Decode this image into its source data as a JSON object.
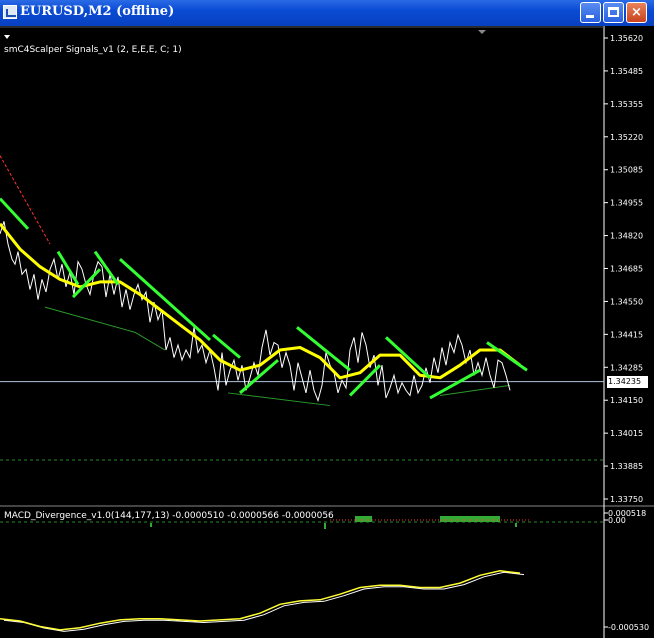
{
  "window": {
    "title": "EURUSD,M2 (offline)",
    "buttons": {
      "minimize": "minimize",
      "maximize": "maximize",
      "close": "×"
    }
  },
  "colors": {
    "background": "#000000",
    "axis": "#ffffff",
    "price_line": "#ffffff",
    "ma_line": "#ffff00",
    "signal_line": "#33ff33",
    "red_dash": "#ff3333",
    "divergence_line": "#2a9a2a",
    "current_price_line": "#b0c4de"
  },
  "indicators": {
    "main": "smC4Scalper Signals_v1 (2, E,E,E, C; 1)",
    "macd": "MACD_Divergence_v1.0(144,177,13) -0.0000510 -0.0000566 -0.0000056"
  },
  "price_axis": {
    "ticks": [
      "1.35620",
      "1.35485",
      "1.35355",
      "1.35220",
      "1.35085",
      "1.34955",
      "1.34820",
      "1.34685",
      "1.34550",
      "1.34415",
      "1.34285",
      "1.34150",
      "1.34015",
      "1.33885",
      "1.33750"
    ],
    "current_price": "1.34235"
  },
  "macd_axis": {
    "top": "0.000518",
    "zero": "0.00",
    "bottom": "-0.000530"
  },
  "chart_data": {
    "type": "line",
    "ylim": [
      1.3375,
      1.3562
    ],
    "price_x": [
      0,
      4,
      8,
      12,
      15,
      18,
      22,
      26,
      30,
      34,
      38,
      42,
      46,
      50,
      54,
      58,
      62,
      66,
      70,
      74,
      78,
      82,
      86,
      90,
      94,
      98,
      102,
      106,
      110,
      114,
      118,
      122,
      126,
      130,
      134,
      138,
      142,
      146,
      150,
      154,
      158,
      162,
      166,
      170,
      174,
      178,
      182,
      186,
      190,
      194,
      198,
      202,
      206,
      210,
      214,
      218,
      222,
      226,
      230,
      234,
      238,
      242,
      246,
      250,
      254,
      258,
      262,
      266,
      270,
      274,
      278,
      282,
      286,
      290,
      294,
      298,
      302,
      306,
      310,
      314,
      318,
      322,
      326,
      330,
      334,
      338,
      342,
      346,
      350,
      354,
      358,
      362,
      366,
      370,
      374,
      378,
      382,
      386,
      390,
      394,
      398,
      402,
      406,
      410,
      414,
      418,
      422,
      426,
      430,
      434,
      438,
      442,
      446,
      450,
      454,
      458,
      462,
      466,
      470,
      474,
      478,
      482,
      486,
      490,
      494,
      498,
      502,
      506,
      510,
      514,
      518,
      522,
      526
    ],
    "price_y": [
      1.3482,
      1.3487,
      1.3478,
      1.3472,
      1.347,
      1.3475,
      1.3466,
      1.3468,
      1.346,
      1.3466,
      1.3456,
      1.3464,
      1.3459,
      1.3468,
      1.3472,
      1.3464,
      1.347,
      1.3461,
      1.3467,
      1.3458,
      1.3471,
      1.3468,
      1.3462,
      1.3458,
      1.3466,
      1.3471,
      1.3469,
      1.3457,
      1.3466,
      1.3458,
      1.3465,
      1.3453,
      1.346,
      1.3452,
      1.3458,
      1.3462,
      1.3456,
      1.3459,
      1.3447,
      1.3455,
      1.3448,
      1.3452,
      1.3436,
      1.3441,
      1.3433,
      1.3438,
      1.3432,
      1.3436,
      1.3433,
      1.3445,
      1.3435,
      1.3438,
      1.3431,
      1.3436,
      1.3429,
      1.342,
      1.3435,
      1.3422,
      1.3428,
      1.3432,
      1.3424,
      1.343,
      1.342,
      1.3425,
      1.3431,
      1.3426,
      1.3437,
      1.3444,
      1.3434,
      1.3439,
      1.3438,
      1.3429,
      1.3435,
      1.343,
      1.342,
      1.3431,
      1.3425,
      1.3419,
      1.3428,
      1.342,
      1.3416,
      1.3422,
      1.3435,
      1.343,
      1.3427,
      1.3419,
      1.3424,
      1.3421,
      1.3436,
      1.3441,
      1.3431,
      1.3443,
      1.3438,
      1.3429,
      1.3434,
      1.3422,
      1.343,
      1.3417,
      1.3421,
      1.3426,
      1.3419,
      1.3423,
      1.342,
      1.3418,
      1.3426,
      1.3419,
      1.3422,
      1.3429,
      1.3423,
      1.3433,
      1.3427,
      1.3437,
      1.343,
      1.3439,
      1.3435,
      1.3442,
      1.3438,
      1.3431,
      1.3436,
      1.3426,
      1.3431,
      1.3426,
      1.3433,
      1.3426,
      1.3421,
      1.3432,
      1.3431,
      1.3426,
      1.342
    ],
    "ma_x": [
      0,
      20,
      40,
      60,
      80,
      100,
      120,
      140,
      160,
      180,
      200,
      220,
      240,
      260,
      280,
      300,
      320,
      340,
      360,
      380,
      400,
      420,
      440,
      460,
      480,
      500,
      520
    ],
    "ma_y": [
      1.3486,
      1.3476,
      1.3469,
      1.3464,
      1.3461,
      1.3463,
      1.3463,
      1.3458,
      1.3452,
      1.3446,
      1.344,
      1.3432,
      1.3428,
      1.343,
      1.3436,
      1.3437,
      1.3433,
      1.3425,
      1.3427,
      1.3434,
      1.3434,
      1.3426,
      1.3425,
      1.343,
      1.3436,
      1.3436,
      1.343
    ],
    "signal_lines": [
      [
        [
          0,
          1.3496
        ],
        [
          28,
          1.3484
        ]
      ],
      [
        [
          58,
          1.3475
        ],
        [
          78,
          1.3462
        ]
      ],
      [
        [
          95,
          1.3475
        ],
        [
          118,
          1.3462
        ]
      ],
      [
        [
          120,
          1.3472
        ],
        [
          210,
          1.344
        ]
      ],
      [
        [
          213,
          1.3442
        ],
        [
          240,
          1.3433
        ]
      ],
      [
        [
          240,
          1.3419
        ],
        [
          278,
          1.3432
        ]
      ],
      [
        [
          297,
          1.3445
        ],
        [
          350,
          1.3428
        ]
      ],
      [
        [
          350,
          1.3418
        ],
        [
          380,
          1.343
        ]
      ],
      [
        [
          386,
          1.3441
        ],
        [
          430,
          1.3425
        ]
      ],
      [
        [
          430,
          1.3417
        ],
        [
          480,
          1.3428
        ]
      ],
      [
        [
          487,
          1.3439
        ],
        [
          527,
          1.3428
        ]
      ],
      [
        [
          73,
          1.3457
        ],
        [
          100,
          1.3468
        ]
      ]
    ],
    "red_dash_lines": [
      [
        [
          0,
          1.3513
        ],
        [
          50,
          1.3478
        ]
      ]
    ],
    "divergence_lines": [
      [
        [
          45,
          1.3453
        ],
        [
          135,
          1.3443
        ]
      ],
      [
        [
          135,
          1.3443
        ],
        [
          165,
          1.3436
        ]
      ],
      [
        [
          228,
          1.3419
        ],
        [
          330,
          1.3414
        ]
      ],
      [
        [
          440,
          1.3418
        ],
        [
          510,
          1.3422
        ]
      ]
    ],
    "macd_x": [
      0,
      20,
      40,
      60,
      80,
      100,
      120,
      140,
      160,
      180,
      200,
      220,
      240,
      260,
      280,
      300,
      320,
      340,
      360,
      380,
      400,
      420,
      440,
      460,
      480,
      500,
      520
    ],
    "macd_y": [
      -0.00044,
      -0.00046,
      -0.00051,
      -0.00054,
      -0.00052,
      -0.00048,
      -0.00045,
      -0.00044,
      -0.00044,
      -0.00045,
      -0.00046,
      -0.00045,
      -0.00044,
      -0.00039,
      -0.00031,
      -0.00028,
      -0.00027,
      -0.00022,
      -0.00016,
      -0.00014,
      -0.00014,
      -0.00016,
      -0.00016,
      -0.00012,
      -5e-05,
      -1e-05,
      -3e-05
    ],
    "macd_ylim": [
      -0.00055,
      0.000518
    ]
  }
}
